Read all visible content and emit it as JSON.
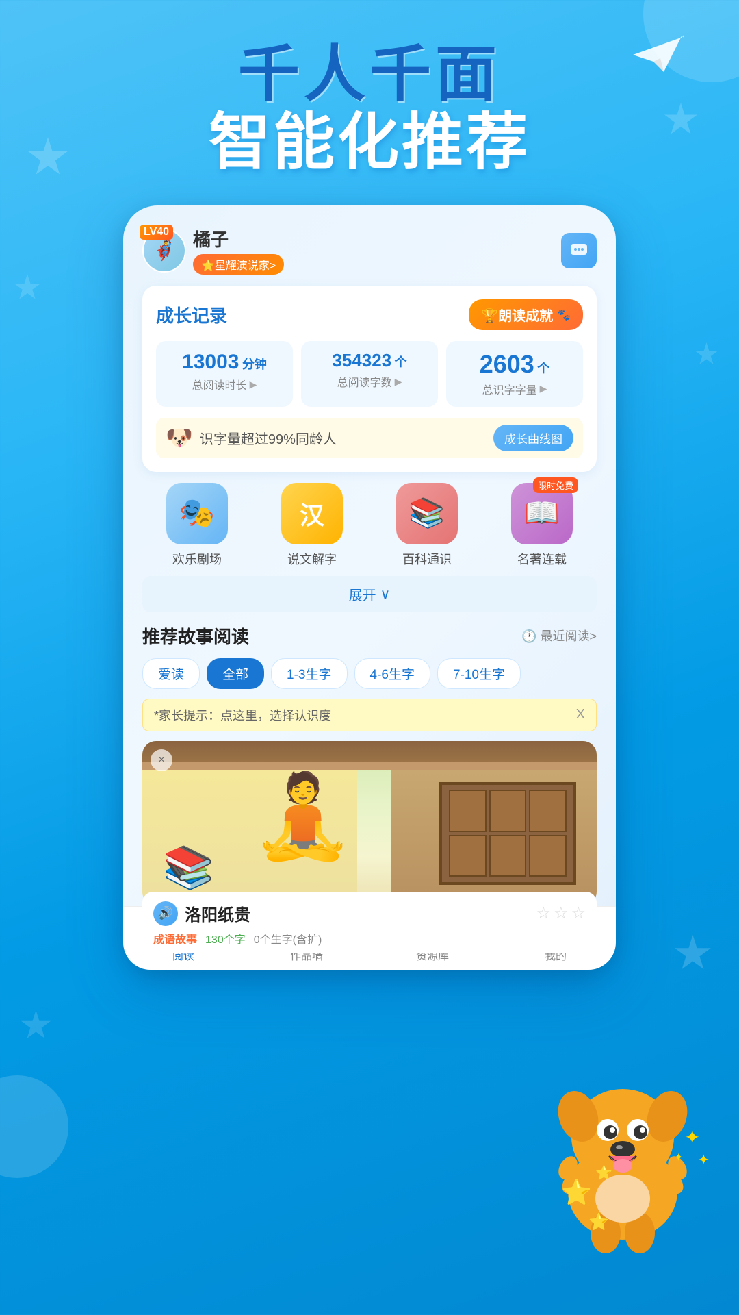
{
  "hero": {
    "title1": "千人千面",
    "title2": "智能化推荐"
  },
  "header": {
    "level_badge": "LV40",
    "username": "橘子",
    "user_role": "⭐星耀演说家>",
    "message_icon": "💬"
  },
  "growth_record": {
    "section_title": "成长记录",
    "achievement_label": "🏆朗读成就",
    "stats": [
      {
        "number": "13003",
        "unit": "分钟",
        "label": "总阅读时长",
        "arrow": "▶"
      },
      {
        "number": "354323",
        "unit": "个",
        "label": "总阅读字数",
        "arrow": "▶"
      },
      {
        "number": "2603",
        "unit": "个",
        "label": "总识字字量",
        "arrow": "▶"
      }
    ],
    "literacy_text": "识字量超过99%同龄人",
    "curve_btn": "成长曲线图"
  },
  "features": [
    {
      "label": "欢乐剧场",
      "emoji": "🎭",
      "color": "theater",
      "free": false
    },
    {
      "label": "说文解字",
      "emoji": "汉",
      "color": "chinese",
      "free": false
    },
    {
      "label": "百科通识",
      "emoji": "📚",
      "color": "encyclopedia",
      "free": false
    },
    {
      "label": "名著连载",
      "emoji": "📖",
      "color": "classics",
      "free": true,
      "free_label": "限时免费"
    }
  ],
  "expand_btn": "展开",
  "recommend": {
    "title": "推荐故事阅读",
    "recent_label": "🕐 最近阅读>",
    "filter_tabs": [
      {
        "label": "爱读",
        "active": false
      },
      {
        "label": "全部",
        "active": true
      },
      {
        "label": "1-3生字",
        "active": false
      },
      {
        "label": "4-6生字",
        "active": false
      },
      {
        "label": "7-10生字",
        "active": false
      }
    ],
    "parent_tip": "*家长提示：点这里，选择认识度",
    "tip_close": "X"
  },
  "story": {
    "title": "洛阳纸贵",
    "type": "成语故事",
    "char_count": "130个字",
    "new_chars": "0个生字(含扩)",
    "close_icon": "×"
  },
  "bottom_nav": [
    {
      "label": "阅读",
      "icon": "📄",
      "active": true
    },
    {
      "label": "作品墙",
      "icon": "🕐",
      "active": false
    },
    {
      "label": "资源库",
      "icon": "📦",
      "active": false
    },
    {
      "label": "我的",
      "icon": "👤",
      "active": false
    }
  ]
}
